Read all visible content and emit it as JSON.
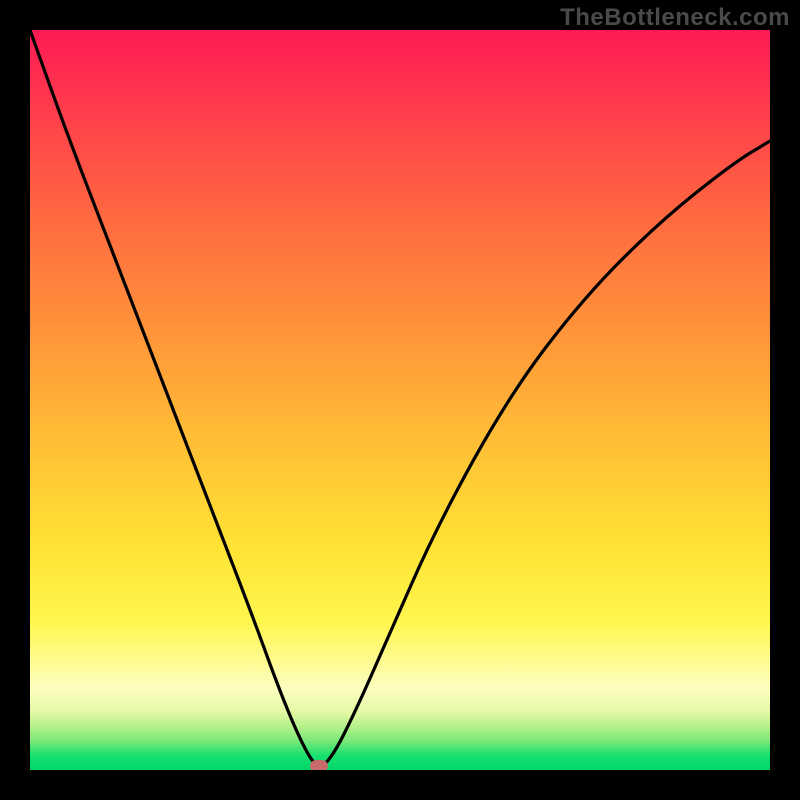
{
  "watermark": "TheBottleneck.com",
  "chart_data": {
    "type": "line",
    "title": "",
    "xlabel": "",
    "ylabel": "",
    "xlim": [
      0,
      1
    ],
    "ylim": [
      0,
      1
    ],
    "gradient_semantics": "top=worst (red), bottom=best (green)",
    "marker": {
      "x": 0.39,
      "y": 0.0,
      "note": "optimal point indicator"
    },
    "series": [
      {
        "name": "bottleneck-curve",
        "x": [
          0.0,
          0.05,
          0.1,
          0.15,
          0.2,
          0.25,
          0.3,
          0.34,
          0.37,
          0.39,
          0.41,
          0.44,
          0.48,
          0.55,
          0.65,
          0.75,
          0.85,
          0.95,
          1.0
        ],
        "y": [
          1.0,
          0.86,
          0.73,
          0.6,
          0.47,
          0.34,
          0.21,
          0.1,
          0.03,
          0.0,
          0.02,
          0.08,
          0.17,
          0.33,
          0.51,
          0.64,
          0.74,
          0.82,
          0.85
        ]
      }
    ]
  }
}
